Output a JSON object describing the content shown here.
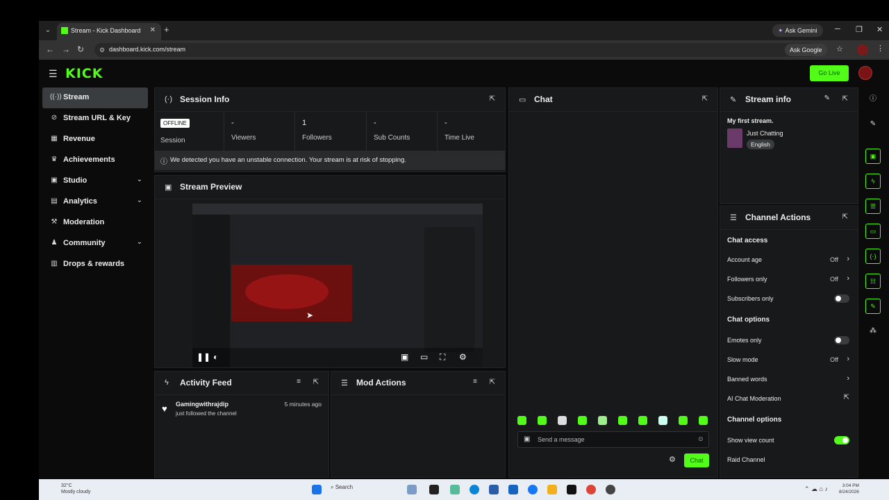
{
  "browser": {
    "tab_title": "Stream - Kick Dashboard",
    "ask_gemini": "Ask Gemini",
    "url": "dashboard.kick.com/stream",
    "ask_google": "Ask Google"
  },
  "header": {
    "logo": "KICK",
    "go_live": "Go Live"
  },
  "sidebar": {
    "items": [
      {
        "label": "Stream",
        "icon": "broadcast-icon"
      },
      {
        "label": "Stream URL & Key",
        "icon": "link-icon"
      },
      {
        "label": "Revenue",
        "icon": "revenue-icon"
      },
      {
        "label": "Achievements",
        "icon": "trophy-icon"
      },
      {
        "label": "Studio",
        "icon": "studio-icon"
      },
      {
        "label": "Analytics",
        "icon": "chart-icon"
      },
      {
        "label": "Moderation",
        "icon": "gavel-icon"
      },
      {
        "label": "Community",
        "icon": "community-icon"
      },
      {
        "label": "Drops & rewards",
        "icon": "gift-icon"
      }
    ]
  },
  "session": {
    "title": "Session Info",
    "status": "OFFLINE",
    "session_label": "Session",
    "viewers_value": "-",
    "viewers_label": "Viewers",
    "followers_value": "1",
    "followers_label": "Followers",
    "subs_value": "-",
    "subs_label": "Sub Counts",
    "time_value": "-",
    "time_label": "Time Live",
    "warning": "We detected you have an unstable connection. Your stream is at risk of stopping."
  },
  "preview": {
    "title": "Stream Preview"
  },
  "activity": {
    "title": "Activity Feed",
    "items": [
      {
        "user": "Gamingwithrajdip",
        "time": "5 minutes ago",
        "desc": "just followed the channel"
      }
    ]
  },
  "mod_actions": {
    "title": "Mod Actions"
  },
  "chat": {
    "title": "Chat",
    "placeholder": "Send a message",
    "send_label": "Chat"
  },
  "stream_info": {
    "title": "Stream info",
    "stream_title": "My first stream.",
    "category": "Just Chatting",
    "language": "English"
  },
  "channel_actions": {
    "title": "Channel Actions",
    "chat_access": "Chat access",
    "account_age": {
      "label": "Account age",
      "value": "Off"
    },
    "followers_only": {
      "label": "Followers only",
      "value": "Off"
    },
    "subscribers_only": {
      "label": "Subscribers only"
    },
    "chat_options": "Chat options",
    "emotes_only": {
      "label": "Emotes only"
    },
    "slow_mode": {
      "label": "Slow mode",
      "value": "Off"
    },
    "banned_words": {
      "label": "Banned words"
    },
    "ai_moderation": {
      "label": "AI Chat Moderation"
    },
    "channel_options": "Channel options",
    "show_view_count": {
      "label": "Show view count"
    },
    "raid_channel": {
      "label": "Raid Channel"
    }
  },
  "taskbar": {
    "temp": "32°C",
    "weather": "Mostly cloudy",
    "search": "Search",
    "time": "3:04 PM",
    "date": "8/24/2026"
  },
  "colors": {
    "accent": "#53fc18",
    "panel": "#18191b"
  }
}
